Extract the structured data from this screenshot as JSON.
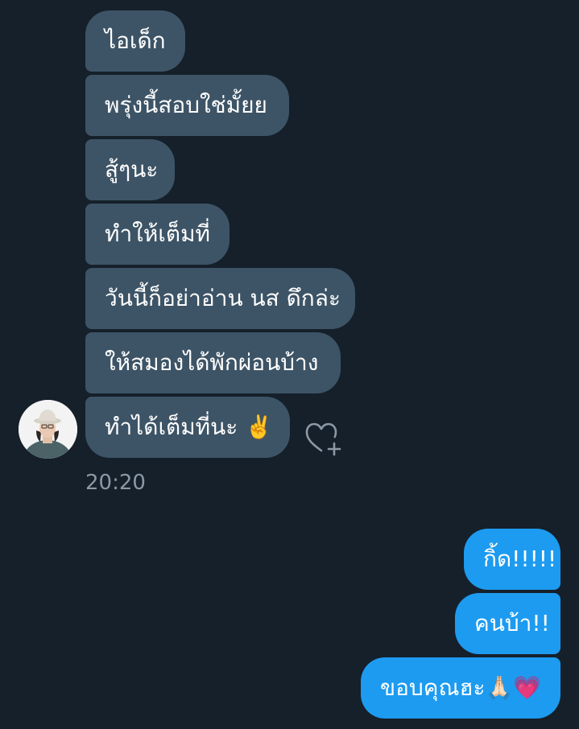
{
  "conversation": {
    "received": [
      {
        "text": "ไอเด็ก"
      },
      {
        "text": "พรุ่งนี้สอบใช่มั้ยย"
      },
      {
        "text": "สู้ๆนะ"
      },
      {
        "text": "ทำให้เต็มที่"
      },
      {
        "text": "วันนี้ก็อย่าอ่าน นส ดึกล่ะ"
      },
      {
        "text": "ให้สมองได้พักผ่อนบ้าง"
      },
      {
        "text": "ทำได้เต็มที่นะ ✌️"
      }
    ],
    "timestamp": "20:20",
    "sent": [
      {
        "text": "กิ้ด!!!!!"
      },
      {
        "text": "คนบ้า!!"
      },
      {
        "text": "ขอบคุณฮะ🙏🏻💗"
      }
    ]
  },
  "icons": {
    "avatar": "user-avatar-photo",
    "react": "heart-plus-icon"
  },
  "colors": {
    "background": "#15202b",
    "received_bubble": "#3d5466",
    "sent_bubble": "#1d9bf0",
    "text": "#ffffff",
    "timestamp": "#8b98a5"
  }
}
